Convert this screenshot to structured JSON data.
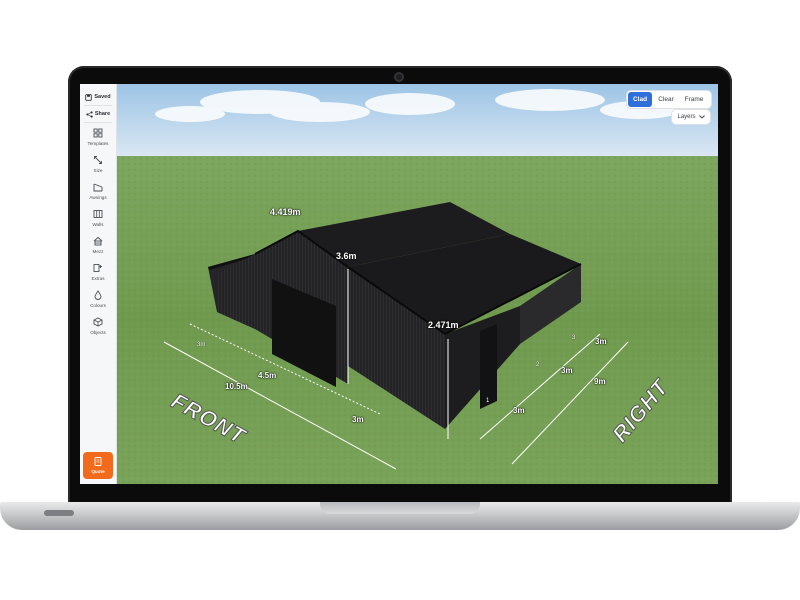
{
  "sidebar": {
    "top": [
      {
        "label": "Saved",
        "icon": "save-icon"
      },
      {
        "label": "Share",
        "icon": "share-icon"
      }
    ],
    "items": [
      {
        "label": "Templates",
        "icon": "templates-icon"
      },
      {
        "label": "Size",
        "icon": "resize-icon"
      },
      {
        "label": "Awnings",
        "icon": "awning-icon"
      },
      {
        "label": "Walls",
        "icon": "walls-icon"
      },
      {
        "label": "Mezz",
        "icon": "mezzanine-icon"
      },
      {
        "label": "Extras",
        "icon": "extras-icon"
      },
      {
        "label": "Colours",
        "icon": "droplet-icon"
      },
      {
        "label": "Objects",
        "icon": "cube-icon"
      }
    ],
    "quote": {
      "label": "Quote",
      "icon": "quote-doc-icon",
      "color": "#f26a1b"
    }
  },
  "view_modes": {
    "options": [
      "Clad",
      "Clear",
      "Frame"
    ],
    "selected": "Clad",
    "accent": "#2f6fd9"
  },
  "layers": {
    "label": "Layers",
    "icon": "chevron-down-icon"
  },
  "dimensions": {
    "roof_span": "4.419m",
    "center_height": "3.6m",
    "side_height": "2.471m",
    "front_total": "10.5m",
    "front_center": "4.5m",
    "front_left": "3m",
    "front_right": "3m",
    "right_total": "9m",
    "right_bays": [
      "3m",
      "3m",
      "3m"
    ],
    "bay_numbers": [
      "1",
      "2",
      "3"
    ]
  },
  "side_labels": {
    "front": "FRONT",
    "right": "RIGHT"
  },
  "colors": {
    "shed": "#1b1b1d",
    "ground": "#6e9a4f",
    "sky": "#c9dff2"
  }
}
